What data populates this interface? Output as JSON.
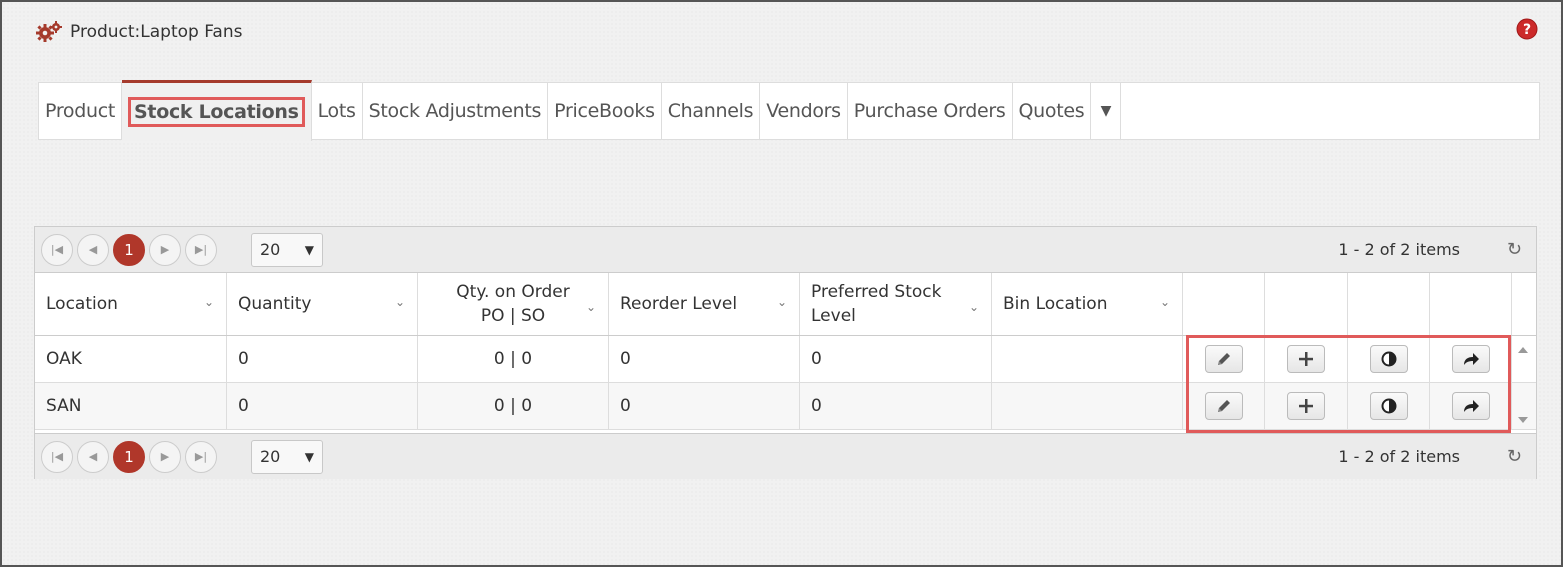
{
  "header": {
    "title": "Product:Laptop Fans",
    "title_icon": "gears-icon",
    "help_icon": "help-icon",
    "accent_color": "#b0372a"
  },
  "tabs": [
    {
      "label": "Product",
      "active": false
    },
    {
      "label": "Stock Locations",
      "active": true
    },
    {
      "label": "Lots",
      "active": false
    },
    {
      "label": "Stock Adjustments",
      "active": false
    },
    {
      "label": "PriceBooks",
      "active": false
    },
    {
      "label": "Channels",
      "active": false
    },
    {
      "label": "Vendors",
      "active": false
    },
    {
      "label": "Purchase Orders",
      "active": false
    },
    {
      "label": "Quotes",
      "active": false
    }
  ],
  "pager": {
    "current_page": "1",
    "page_size": "20",
    "info": "1 - 2 of 2 items"
  },
  "columns": {
    "location": "Location",
    "quantity": "Quantity",
    "qty_on_order_line1": "Qty. on Order",
    "qty_on_order_line2": "PO | SO",
    "reorder_level": "Reorder Level",
    "preferred_line1": "Preferred Stock",
    "preferred_line2": "Level",
    "bin_location": "Bin Location"
  },
  "rows": [
    {
      "location": "OAK",
      "quantity": "0",
      "qty_on_order": "0 | 0",
      "reorder_level": "0",
      "preferred": "0",
      "bin_location": ""
    },
    {
      "location": "SAN",
      "quantity": "0",
      "qty_on_order": "0 | 0",
      "reorder_level": "0",
      "preferred": "0",
      "bin_location": ""
    }
  ],
  "row_actions": [
    "pencil-icon",
    "plus-icon",
    "contrast-icon",
    "share-icon"
  ]
}
